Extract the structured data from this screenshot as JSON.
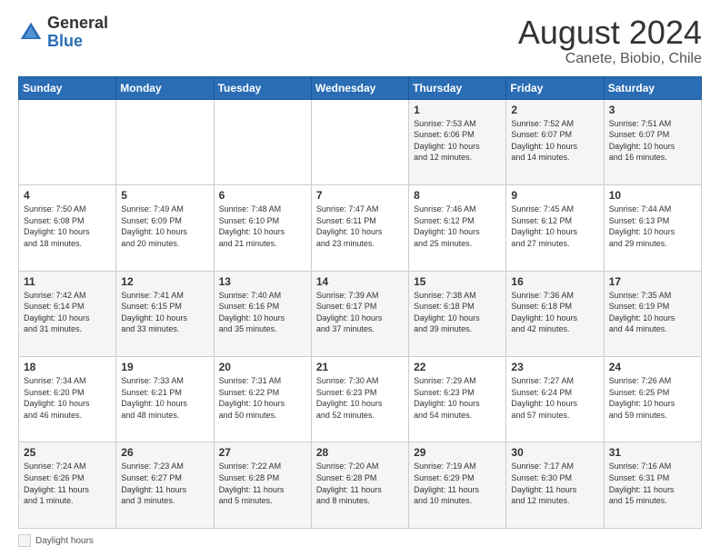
{
  "header": {
    "logo_general": "General",
    "logo_blue": "Blue",
    "month_year": "August 2024",
    "location": "Canete, Biobio, Chile"
  },
  "days_of_week": [
    "Sunday",
    "Monday",
    "Tuesday",
    "Wednesday",
    "Thursday",
    "Friday",
    "Saturday"
  ],
  "weeks": [
    [
      {
        "day": "",
        "info": ""
      },
      {
        "day": "",
        "info": ""
      },
      {
        "day": "",
        "info": ""
      },
      {
        "day": "",
        "info": ""
      },
      {
        "day": "1",
        "info": "Sunrise: 7:53 AM\nSunset: 6:06 PM\nDaylight: 10 hours\nand 12 minutes."
      },
      {
        "day": "2",
        "info": "Sunrise: 7:52 AM\nSunset: 6:07 PM\nDaylight: 10 hours\nand 14 minutes."
      },
      {
        "day": "3",
        "info": "Sunrise: 7:51 AM\nSunset: 6:07 PM\nDaylight: 10 hours\nand 16 minutes."
      }
    ],
    [
      {
        "day": "4",
        "info": "Sunrise: 7:50 AM\nSunset: 6:08 PM\nDaylight: 10 hours\nand 18 minutes."
      },
      {
        "day": "5",
        "info": "Sunrise: 7:49 AM\nSunset: 6:09 PM\nDaylight: 10 hours\nand 20 minutes."
      },
      {
        "day": "6",
        "info": "Sunrise: 7:48 AM\nSunset: 6:10 PM\nDaylight: 10 hours\nand 21 minutes."
      },
      {
        "day": "7",
        "info": "Sunrise: 7:47 AM\nSunset: 6:11 PM\nDaylight: 10 hours\nand 23 minutes."
      },
      {
        "day": "8",
        "info": "Sunrise: 7:46 AM\nSunset: 6:12 PM\nDaylight: 10 hours\nand 25 minutes."
      },
      {
        "day": "9",
        "info": "Sunrise: 7:45 AM\nSunset: 6:12 PM\nDaylight: 10 hours\nand 27 minutes."
      },
      {
        "day": "10",
        "info": "Sunrise: 7:44 AM\nSunset: 6:13 PM\nDaylight: 10 hours\nand 29 minutes."
      }
    ],
    [
      {
        "day": "11",
        "info": "Sunrise: 7:42 AM\nSunset: 6:14 PM\nDaylight: 10 hours\nand 31 minutes."
      },
      {
        "day": "12",
        "info": "Sunrise: 7:41 AM\nSunset: 6:15 PM\nDaylight: 10 hours\nand 33 minutes."
      },
      {
        "day": "13",
        "info": "Sunrise: 7:40 AM\nSunset: 6:16 PM\nDaylight: 10 hours\nand 35 minutes."
      },
      {
        "day": "14",
        "info": "Sunrise: 7:39 AM\nSunset: 6:17 PM\nDaylight: 10 hours\nand 37 minutes."
      },
      {
        "day": "15",
        "info": "Sunrise: 7:38 AM\nSunset: 6:18 PM\nDaylight: 10 hours\nand 39 minutes."
      },
      {
        "day": "16",
        "info": "Sunrise: 7:36 AM\nSunset: 6:18 PM\nDaylight: 10 hours\nand 42 minutes."
      },
      {
        "day": "17",
        "info": "Sunrise: 7:35 AM\nSunset: 6:19 PM\nDaylight: 10 hours\nand 44 minutes."
      }
    ],
    [
      {
        "day": "18",
        "info": "Sunrise: 7:34 AM\nSunset: 6:20 PM\nDaylight: 10 hours\nand 46 minutes."
      },
      {
        "day": "19",
        "info": "Sunrise: 7:33 AM\nSunset: 6:21 PM\nDaylight: 10 hours\nand 48 minutes."
      },
      {
        "day": "20",
        "info": "Sunrise: 7:31 AM\nSunset: 6:22 PM\nDaylight: 10 hours\nand 50 minutes."
      },
      {
        "day": "21",
        "info": "Sunrise: 7:30 AM\nSunset: 6:23 PM\nDaylight: 10 hours\nand 52 minutes."
      },
      {
        "day": "22",
        "info": "Sunrise: 7:29 AM\nSunset: 6:23 PM\nDaylight: 10 hours\nand 54 minutes."
      },
      {
        "day": "23",
        "info": "Sunrise: 7:27 AM\nSunset: 6:24 PM\nDaylight: 10 hours\nand 57 minutes."
      },
      {
        "day": "24",
        "info": "Sunrise: 7:26 AM\nSunset: 6:25 PM\nDaylight: 10 hours\nand 59 minutes."
      }
    ],
    [
      {
        "day": "25",
        "info": "Sunrise: 7:24 AM\nSunset: 6:26 PM\nDaylight: 11 hours\nand 1 minute."
      },
      {
        "day": "26",
        "info": "Sunrise: 7:23 AM\nSunset: 6:27 PM\nDaylight: 11 hours\nand 3 minutes."
      },
      {
        "day": "27",
        "info": "Sunrise: 7:22 AM\nSunset: 6:28 PM\nDaylight: 11 hours\nand 5 minutes."
      },
      {
        "day": "28",
        "info": "Sunrise: 7:20 AM\nSunset: 6:28 PM\nDaylight: 11 hours\nand 8 minutes."
      },
      {
        "day": "29",
        "info": "Sunrise: 7:19 AM\nSunset: 6:29 PM\nDaylight: 11 hours\nand 10 minutes."
      },
      {
        "day": "30",
        "info": "Sunrise: 7:17 AM\nSunset: 6:30 PM\nDaylight: 11 hours\nand 12 minutes."
      },
      {
        "day": "31",
        "info": "Sunrise: 7:16 AM\nSunset: 6:31 PM\nDaylight: 11 hours\nand 15 minutes."
      }
    ]
  ],
  "legend": {
    "daylight_label": "Daylight hours"
  }
}
